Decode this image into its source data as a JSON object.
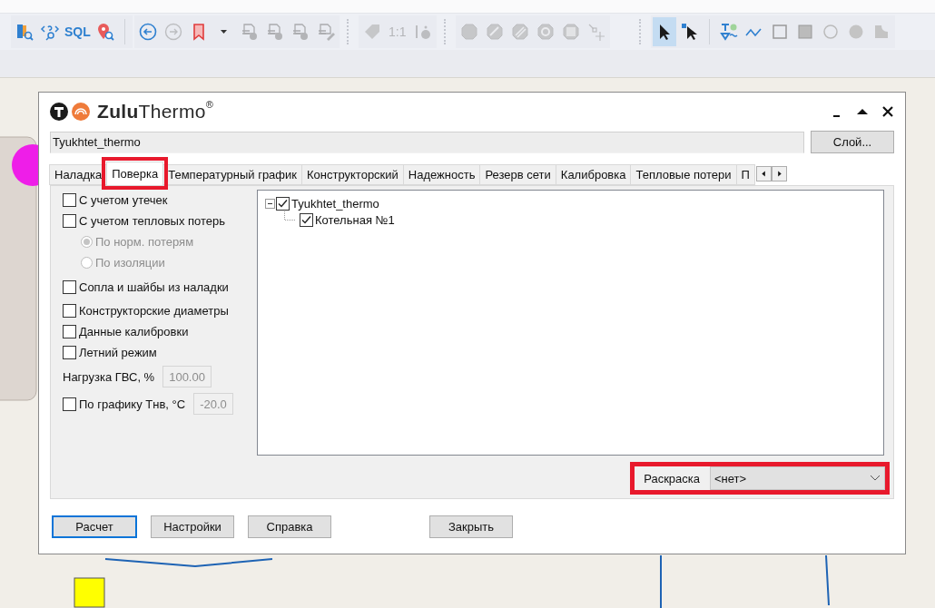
{
  "toolbar": {
    "groups": [
      {
        "items": [
          {
            "kind": "icon",
            "disabled": false
          },
          {
            "kind": "icon",
            "disabled": false
          },
          {
            "kind": "text",
            "label": "SQL",
            "disabled": false
          },
          {
            "kind": "icon",
            "disabled": false
          }
        ]
      },
      {
        "items": [
          {
            "kind": "icon",
            "disabled": false
          },
          {
            "kind": "icon",
            "disabled": true
          },
          {
            "kind": "icon",
            "disabled": false
          },
          {
            "kind": "icon",
            "disabled": false
          },
          {
            "kind": "icon",
            "disabled": true
          },
          {
            "kind": "icon",
            "disabled": true
          },
          {
            "kind": "icon",
            "disabled": true
          },
          {
            "kind": "icon",
            "disabled": true
          }
        ]
      },
      {
        "items": [
          {
            "kind": "icon",
            "disabled": true
          },
          {
            "kind": "text",
            "label": "1:1",
            "disabled": true
          },
          {
            "kind": "icon",
            "disabled": true
          }
        ]
      },
      {
        "items": [
          {
            "kind": "icon",
            "disabled": true
          },
          {
            "kind": "icon",
            "disabled": true
          },
          {
            "kind": "icon",
            "disabled": true
          },
          {
            "kind": "icon",
            "disabled": true
          },
          {
            "kind": "icon",
            "disabled": true
          },
          {
            "kind": "icon",
            "disabled": true
          }
        ]
      },
      {
        "items": [
          {
            "kind": "icon",
            "disabled": false,
            "selected": true
          },
          {
            "kind": "icon",
            "disabled": false,
            "selected": false
          },
          {
            "kind": "icon",
            "disabled": false,
            "selected": false
          },
          {
            "kind": "icon",
            "disabled": false,
            "selected": false
          },
          {
            "kind": "icon",
            "disabled": false,
            "selected": false
          },
          {
            "kind": "icon",
            "disabled": false,
            "selected": false
          },
          {
            "kind": "icon",
            "disabled": false,
            "selected": false
          },
          {
            "kind": "icon",
            "disabled": false,
            "selected": false
          },
          {
            "kind": "icon",
            "disabled": false,
            "selected": false
          }
        ]
      }
    ]
  },
  "dialog": {
    "title": "**Zulu**Thermo$^{®}$",
    "layer": {
      "value": "Tyukhtet_thermo",
      "button": "Слой..."
    },
    "tabs": [
      {
        "label": "Наладка",
        "selected": false,
        "highlighted": false
      },
      {
        "label": "Поверка",
        "selected": true,
        "highlighted": true
      },
      {
        "label": "Температурный график",
        "selected": false,
        "highlighted": false
      },
      {
        "label": "Конструкторский",
        "selected": false,
        "highlighted": false
      },
      {
        "label": "Надежность",
        "selected": false,
        "highlighted": false
      },
      {
        "label": "Резерв сети",
        "selected": false,
        "highlighted": false
      },
      {
        "label": "Калибровка",
        "selected": false,
        "highlighted": false
      },
      {
        "label": "Тепловые потери",
        "selected": false,
        "highlighted": false
      },
      {
        "label": "П",
        "selected": false,
        "highlighted": false
      }
    ],
    "options": [
      {
        "kind": "checkbox",
        "label": "С учетом утечек",
        "checked": false
      },
      {
        "kind": "checkbox",
        "label": "С учетом тепловых потерь",
        "checked": false
      },
      {
        "kind": "radio",
        "label": "По норм. потерям",
        "selected": true,
        "disabled": true
      },
      {
        "kind": "radio",
        "label": "По изоляции",
        "selected": false,
        "disabled": true
      },
      {
        "kind": "checkbox",
        "label": "Сопла и шайбы из наладки",
        "checked": false
      },
      {
        "kind": "checkbox",
        "label": "Конструкторские диаметры",
        "checked": false
      },
      {
        "kind": "checkbox",
        "label": "Данные калибровки",
        "checked": false
      },
      {
        "kind": "checkbox",
        "label": "Летний режим",
        "checked": false
      },
      {
        "kind": "field",
        "label": "Нагрузка ГВС, %",
        "value": "100.00",
        "disabled": true
      },
      {
        "kind": "checkbox-field",
        "label": "По графику Тнв, °C",
        "checked": false,
        "value": "-20.0",
        "disabled": true
      }
    ],
    "tree": [
      {
        "label": "Tyukhtet_thermo",
        "checked": true,
        "expanded": true,
        "children": [
          {
            "label": "Котельная №1",
            "checked": true
          }
        ]
      }
    ],
    "coloring": {
      "label": "Раскраска",
      "value": "<нет>",
      "highlighted": true
    },
    "buttons": [
      {
        "label": "Расчет",
        "focused": true
      },
      {
        "label": "Настройки",
        "focused": false
      },
      {
        "label": "Справка",
        "focused": false
      },
      {
        "label": "Закрыть",
        "focused": false
      }
    ]
  }
}
